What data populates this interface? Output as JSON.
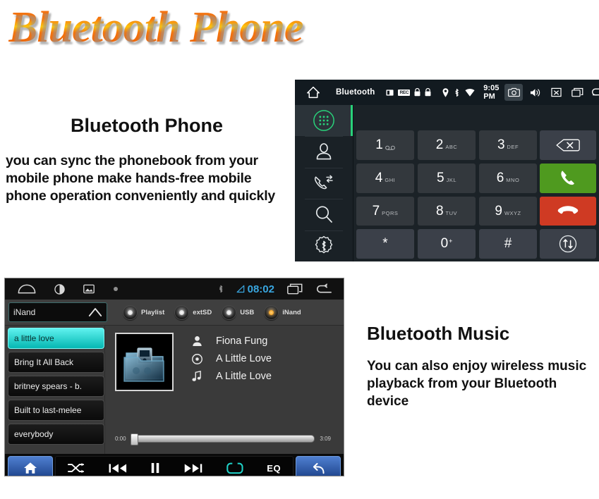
{
  "banner": {
    "title": "Bluetooth Phone",
    "color": "#f4760f"
  },
  "phone_section": {
    "heading": "Bluetooth Phone",
    "body": "you can sync the phonebook from your mobile phone make hands-free mobile phone operation conveniently and quickly"
  },
  "music_section": {
    "heading": "Bluetooth Music",
    "body": "You can also enjoy wireless music playback from your Bluetooth device"
  },
  "dialer": {
    "status": {
      "title": "Bluetooth",
      "clock": "9:05 PM",
      "icons": [
        "home-icon",
        "sdcard-icon",
        "rec-icon",
        "lock-icon",
        "lock-icon",
        "location-icon",
        "bluetooth-icon",
        "wifi-icon"
      ],
      "rec_label": "REC",
      "nav_icons": [
        "camera-icon",
        "volume-icon",
        "mute-icon",
        "recents-icon",
        "back-icon"
      ]
    },
    "sidebar": [
      {
        "name": "dialpad",
        "active": true
      },
      {
        "name": "contacts",
        "active": false
      },
      {
        "name": "call-log",
        "active": false
      },
      {
        "name": "search",
        "active": false
      },
      {
        "name": "bluetooth-settings",
        "active": false
      }
    ],
    "number_display": "",
    "keys": [
      {
        "num": "1",
        "sub": "",
        "voicemail": true
      },
      {
        "num": "2",
        "sub": "ABC"
      },
      {
        "num": "3",
        "sub": "DEF"
      },
      {
        "num": "4",
        "sub": "GHI"
      },
      {
        "num": "5",
        "sub": "JKL"
      },
      {
        "num": "6",
        "sub": "MNO"
      },
      {
        "num": "7",
        "sub": "PQRS"
      },
      {
        "num": "8",
        "sub": "TUV"
      },
      {
        "num": "9",
        "sub": "WXYZ"
      },
      {
        "num": "*",
        "sub": ""
      },
      {
        "num": "0",
        "sub": "",
        "plus": "+"
      },
      {
        "num": "#",
        "sub": ""
      }
    ],
    "side_buttons": [
      {
        "name": "backspace",
        "style": "dark",
        "color": "#3b4049"
      },
      {
        "name": "call",
        "style": "green",
        "color": "#4f9a1f"
      },
      {
        "name": "hangup",
        "style": "red",
        "color": "#cf3a23"
      },
      {
        "name": "transfer",
        "style": "dark",
        "color": "#3b4049"
      }
    ]
  },
  "player": {
    "status": {
      "clock": "08:02",
      "clock_color": "#39a6e0",
      "icons": [
        "home-icon",
        "brightness-icon",
        "gallery-icon",
        "dot-icon",
        "bluetooth-icon",
        "signal-icon",
        "recents-icon",
        "back-icon"
      ]
    },
    "source_dropdown": {
      "label": "iNand"
    },
    "sources": [
      {
        "label": "Playlist",
        "selected": false
      },
      {
        "label": "extSD",
        "selected": false
      },
      {
        "label": "USB",
        "selected": false
      },
      {
        "label": "iNand",
        "selected": true
      }
    ],
    "playlist": [
      {
        "title": "a little love",
        "selected": true
      },
      {
        "title": "Bring It All Back",
        "selected": false
      },
      {
        "title": "britney spears - b.",
        "selected": false
      },
      {
        "title": "Built to last-melee",
        "selected": false
      },
      {
        "title": "everybody",
        "selected": false
      }
    ],
    "now_playing": {
      "artist": "Fiona Fung",
      "album": "A Little Love",
      "track": "A Little Love",
      "elapsed": "0:00",
      "duration": "3:09",
      "progress_percent": 1
    },
    "controls": [
      {
        "name": "home",
        "label": ""
      },
      {
        "name": "shuffle",
        "label": ""
      },
      {
        "name": "previous",
        "label": ""
      },
      {
        "name": "pause",
        "label": ""
      },
      {
        "name": "next",
        "label": ""
      },
      {
        "name": "repeat",
        "label": "",
        "color": "#1fd3c9"
      },
      {
        "name": "eq",
        "label": "EQ"
      },
      {
        "name": "back",
        "label": ""
      }
    ]
  }
}
